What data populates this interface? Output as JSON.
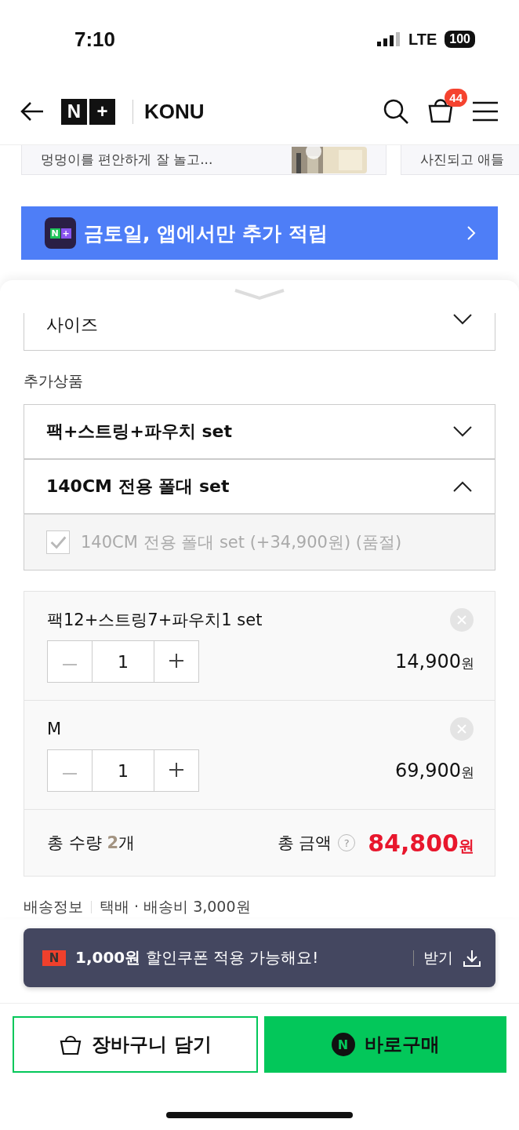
{
  "status_bar": {
    "time": "7:10",
    "network": "LTE",
    "battery": "100"
  },
  "header": {
    "logo_left": "N",
    "logo_right": "+",
    "brand": "KONU",
    "cart_count": "44"
  },
  "cards": [
    {
      "text": "멍멍이를 편안하게 잘 놀고..."
    },
    {
      "text": "사진되고 애들"
    }
  ],
  "banner": {
    "icon_left": "N",
    "icon_right": "+",
    "text": "금토일, 앱에서만 추가 적립"
  },
  "size_select": {
    "label": "사이즈",
    "expanded": false
  },
  "addon_label": "추가상품",
  "addon_selects": [
    {
      "label": "팩+스트링+파우치 set",
      "expanded": false
    },
    {
      "label": "140CM 전용 폴대 set",
      "expanded": true,
      "options": [
        {
          "label": "140CM 전용 폴대 set (+34,900원) (품절)",
          "checked": true,
          "disabled": true
        }
      ]
    }
  ],
  "cart_items": [
    {
      "name": "팩12+스트링7+파우치1 set",
      "quantity": "1",
      "price": "14,900",
      "unit": "원"
    },
    {
      "name": "M",
      "quantity": "1",
      "price": "69,900",
      "unit": "원"
    }
  ],
  "summary": {
    "qty_label": "총 수량",
    "qty": "2",
    "qty_unit": "개",
    "amount_label": "총 금액",
    "help": "?",
    "amount": "84,800",
    "amount_unit": "원"
  },
  "delivery": {
    "label": "배송정보",
    "value": "택배 · 배송비 3,000원"
  },
  "coupon_toast": {
    "icon": "N",
    "text": "**1,000원** 할인쿠폰 적용 가능해요!",
    "action": "받기"
  },
  "buttons": [
    {
      "kind": "cart",
      "label": "장바구니 담기"
    },
    {
      "kind": "buy",
      "icon": "N",
      "label": "바로구매"
    }
  ]
}
